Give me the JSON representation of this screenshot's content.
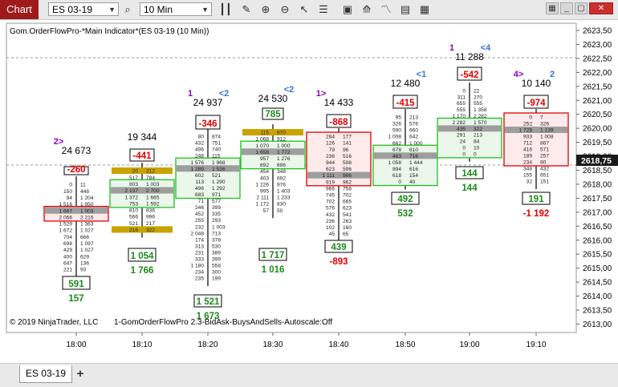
{
  "toolbar": {
    "window_label": "Chart",
    "instrument": "ES 03-19",
    "interval": "10 Min",
    "icons": [
      "search-icon",
      "bar-type-icon",
      "pencil-icon",
      "zoom-in-icon",
      "zoom-out-icon",
      "cursor-icon",
      "properties-icon",
      "indicators-icon",
      "strategies-icon",
      "templates-icon",
      "data-box-icon"
    ],
    "window_buttons": [
      "settings",
      "minimize",
      "maximize",
      "close"
    ]
  },
  "chart": {
    "indicator_label": "Gom.OrderFlowPro-*Main Indicator*(ES 03-19 (10 Min))",
    "copyright": "© 2019 NinjaTrader, LLC",
    "footer_label": "1-GomOrderFlowPro 2.3-BidAsk-BuysAndSells-Autoscale:Off",
    "current_price": "2618,75",
    "price_ticks": [
      "2623,50",
      "2623,00",
      "2622,50",
      "2622,00",
      "2621,50",
      "2621,00",
      "2620,50",
      "2620,00",
      "2619,50",
      "2619,00",
      "2618,50",
      "2618,00",
      "2617,50",
      "2617,00",
      "2616,50",
      "2616,00",
      "2615,50",
      "2615,00",
      "2614,50",
      "2614,00",
      "2613,50",
      "2613,00"
    ],
    "time_labels": [
      "18:00",
      "18:10",
      "18:20",
      "18:30",
      "18:40",
      "18:50",
      "19:00",
      "19:10"
    ]
  },
  "bars": [
    {
      "time": "18:00",
      "signal": "2>",
      "signal_color": "#8a00c8",
      "volume": "24 673",
      "delta": "-260",
      "delta_color": "#e00000",
      "bid": [
        "0",
        "150",
        "94",
        "1 516",
        "1 667",
        "2 066",
        "1 529",
        "1 672",
        "704",
        "698",
        "429",
        "400",
        "647",
        "221"
      ],
      "ask": [
        "11",
        "448",
        "1 204",
        "1 950",
        "1 003",
        "2 215",
        "1 363",
        "1 027",
        "666",
        "1 097",
        "1 027",
        "629",
        "136",
        "93"
      ],
      "bottom_box": "591",
      "bottom_val": "157",
      "bottom_val_color": "#1b8a1b"
    },
    {
      "time": "18:10",
      "signal": "",
      "volume": "19 344",
      "delta": "-441",
      "delta_color": "#e00000",
      "bid": [
        "20",
        "517",
        "803",
        "2 137",
        "1 372",
        "753",
        "810",
        "566",
        "521",
        "216"
      ],
      "ask": [
        "212",
        "784",
        "1 003",
        "2 700",
        "1 665",
        "1 592",
        "836",
        "996",
        "217",
        "322"
      ],
      "bottom_box": "1 054",
      "bottom_val": "1 766",
      "bottom_val_color": "#1b8a1b"
    },
    {
      "time": "18:20",
      "signal": "1",
      "signal_color": "#8a00c8",
      "signal2": "<2",
      "signal2_color": "#3a6fd8",
      "volume": "24 937",
      "delta": "-346",
      "delta_color": "#e00000",
      "bid": [
        "80",
        "432",
        "496",
        "248",
        "1 576",
        "1 289",
        "602",
        "113",
        "496",
        "683",
        "71",
        "246",
        "452",
        "255",
        "232",
        "2 048",
        "174",
        "313",
        "231",
        "333",
        "1 180",
        "234",
        "235"
      ],
      "ask": [
        "874",
        "751",
        "740",
        "115",
        "1 968",
        "1 536",
        "521",
        "1 290",
        "1 292",
        "971",
        "577",
        "399",
        "335",
        "293",
        "1 003",
        "713",
        "378",
        "530",
        "389",
        "399",
        "558",
        "300",
        "199"
      ],
      "bottom_box": "1 521",
      "bottom_val": "1 673",
      "bottom_val_color": "#1b8a1b"
    },
    {
      "time": "18:30",
      "signal": "",
      "signal2": "<2",
      "signal2_color": "#3a6fd8",
      "volume": "24 530",
      "top_box": "785",
      "top_box_color": "#1b8a1b",
      "bid": [
        "115",
        "1 068",
        "1 070",
        "1 658",
        "957",
        "692",
        "454",
        "403",
        "1 226",
        "995",
        "2 111",
        "1 172",
        "57"
      ],
      "ask": [
        "670",
        "912",
        "1 000",
        "1 772",
        "1 276",
        "696",
        "348",
        "692",
        "976",
        "1 403",
        "1 233",
        "830",
        "50"
      ],
      "bottom_box": "1 717",
      "bottom_val": "1 016",
      "bottom_val_color": "#1b8a1b"
    },
    {
      "time": "18:40",
      "signal": "1>",
      "signal_color": "#8a00c8",
      "volume": "14 433",
      "delta": "-868",
      "delta_color": "#e00000",
      "bid": [
        "284",
        "126",
        "79",
        "236",
        "944",
        "623",
        "1 111",
        "919",
        "966",
        "745",
        "702",
        "576",
        "432",
        "236",
        "102",
        "45"
      ],
      "ask": [
        "177",
        "141",
        "96",
        "516",
        "598",
        "596",
        "986",
        "962",
        "758",
        "702",
        "665",
        "623",
        "541",
        "263",
        "160",
        "65"
      ],
      "bottom_box": "439",
      "bottom_val": "-893",
      "bottom_val_color": "#e00000"
    },
    {
      "time": "18:50",
      "signal": "",
      "signal2": "<1",
      "signal2_color": "#3a6fd8",
      "volume": "12 480",
      "delta": "-415",
      "delta_color": "#e00000",
      "bid": [
        "95",
        "326",
        "590",
        "1 008",
        "662",
        "678",
        "463",
        "1 058",
        "894",
        "618",
        "0"
      ],
      "ask": [
        "213",
        "576",
        "660",
        "642",
        "1 000",
        "610",
        "716",
        "1 444",
        "616",
        "154",
        "40"
      ],
      "bottom_box": "492",
      "bottom_val": "532",
      "bottom_val_color": "#1b8a1b"
    },
    {
      "time": "19:00",
      "signal": "1",
      "signal_color": "#8a00c8",
      "signal2": "<4",
      "signal2_color": "#3a6fd8",
      "volume": "11 288",
      "delta": "-542",
      "delta_color": "#e00000",
      "bid": [
        "0",
        "311",
        "655",
        "555",
        "1 170",
        "2 282",
        "435",
        "291",
        "24",
        "0",
        "0"
      ],
      "ask": [
        "22",
        "270",
        "555",
        "1 358",
        "2 282",
        "1 570",
        "322",
        "213",
        "84",
        "10",
        "0"
      ],
      "bottom_box": "144",
      "bottom_val": "144",
      "bottom_val_color": "#1b8a1b"
    },
    {
      "time": "19:10",
      "signal": "4>",
      "signal_color": "#8a00c8",
      "signal2": "2",
      "signal2_color": "#3a6fd8",
      "volume": "10 140",
      "delta": "-974",
      "delta_color": "#e00000",
      "bid": [
        "0",
        "252",
        "1 728",
        "933",
        "712",
        "416",
        "189",
        "234",
        "348",
        "155",
        "32"
      ],
      "ask": [
        "7",
        "326",
        "1 139",
        "1 008",
        "867",
        "571",
        "257",
        "80",
        "432",
        "651",
        "151"
      ],
      "bottom_box": "191",
      "bottom_val": "-1 192",
      "bottom_val_color": "#e00000"
    }
  ],
  "bottom_tabs": {
    "active_tab": "ES 03-19",
    "add_label": "+"
  }
}
